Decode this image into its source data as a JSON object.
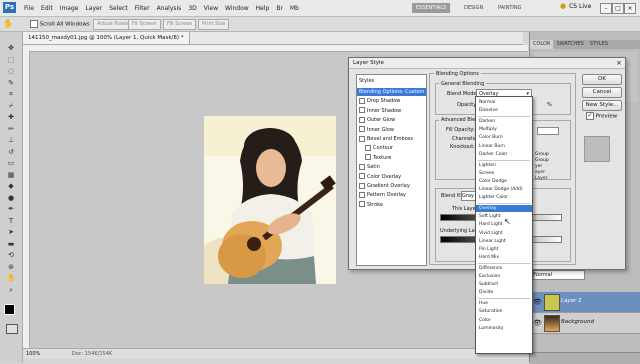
{
  "menubar": {
    "logo": "Ps",
    "items": [
      "File",
      "Edit",
      "Image",
      "Layer",
      "Select",
      "Filter",
      "Analysis",
      "3D",
      "View",
      "Window",
      "Help",
      "Br",
      "Mb"
    ],
    "workspaces": [
      "ESSENTIALS",
      "DESIGN",
      "PAINTING"
    ],
    "cslive": "CS Live"
  },
  "options": {
    "scroll_all": "Scroll All Windows",
    "buttons": [
      "Actual Pixels",
      "Fit Screen",
      "Fill Screen",
      "Print Size"
    ]
  },
  "document": {
    "tab": "141150_masdy01.jpg @ 100% (Layer 1, Quick Mask/8) *",
    "zoom": "100%",
    "doc_info": "Doc: 154K/154K"
  },
  "panels": {
    "tabs": [
      "COLOR",
      "SWATCHES",
      "STYLES"
    ],
    "blend": "Normal",
    "layers": [
      {
        "name": "Layer 1",
        "selected": true
      },
      {
        "name": "Background",
        "selected": false
      }
    ]
  },
  "dialog": {
    "title": "Layer Style",
    "styles_header": "Styles",
    "styles": [
      {
        "label": "Blending Options: Custom",
        "selected": true,
        "check": false
      },
      {
        "label": "Drop Shadow",
        "check": true
      },
      {
        "label": "Inner Shadow",
        "check": true
      },
      {
        "label": "Outer Glow",
        "check": true
      },
      {
        "label": "Inner Glow",
        "check": true
      },
      {
        "label": "Bevel and Emboss",
        "check": true
      },
      {
        "label": "Contour",
        "check": true,
        "indent": true
      },
      {
        "label": "Texture",
        "check": true,
        "indent": true
      },
      {
        "label": "Satin",
        "check": true
      },
      {
        "label": "Color Overlay",
        "check": true
      },
      {
        "label": "Gradient Overlay",
        "check": true
      },
      {
        "label": "Pattern Overlay",
        "check": true
      },
      {
        "label": "Stroke",
        "check": true
      }
    ],
    "blending_options": "Blending Options",
    "general_blending": "General Blending",
    "blend_mode_label": "Blend Mode:",
    "blend_mode_value": "Overlay",
    "opacity_label": "Opacity:",
    "opacity_value": "%",
    "advanced_blending": "Advanced Blen",
    "fill_opacity": "Fill Opacity:",
    "channels": "Channels:",
    "knockout": "Knockout:",
    "right_opts": [
      "Group",
      "Group",
      "yer",
      "ayer",
      "Layer"
    ],
    "blend_if": "Blend If:",
    "blend_if_value": "Gray",
    "this_layer": "This Layer:",
    "underlying": "Underlying Layer:",
    "buttons": {
      "ok": "OK",
      "cancel": "Cancel",
      "new_style": "New Style...",
      "preview": "Preview"
    }
  },
  "blend_modes": [
    {
      "label": "Normal"
    },
    {
      "label": "Dissolve"
    },
    {
      "sep": true
    },
    {
      "label": "Darken"
    },
    {
      "label": "Multiply"
    },
    {
      "label": "Color Burn"
    },
    {
      "label": "Linear Burn"
    },
    {
      "label": "Darker Color"
    },
    {
      "sep": true
    },
    {
      "label": "Lighten"
    },
    {
      "label": "Screen"
    },
    {
      "label": "Color Dodge"
    },
    {
      "label": "Linear Dodge (Add)"
    },
    {
      "label": "Lighter Color"
    },
    {
      "sep": true
    },
    {
      "label": "Overlay",
      "highlighted": true
    },
    {
      "label": "Soft Light"
    },
    {
      "label": "Hard Light"
    },
    {
      "label": "Vivid Light"
    },
    {
      "label": "Linear Light"
    },
    {
      "label": "Pin Light"
    },
    {
      "label": "Hard Mix"
    },
    {
      "sep": true
    },
    {
      "label": "Difference"
    },
    {
      "label": "Exclusion"
    },
    {
      "label": "Subtract"
    },
    {
      "label": "Divide"
    },
    {
      "sep": true
    },
    {
      "label": "Hue"
    },
    {
      "label": "Saturation"
    },
    {
      "label": "Color"
    },
    {
      "label": "Luminosity"
    }
  ]
}
